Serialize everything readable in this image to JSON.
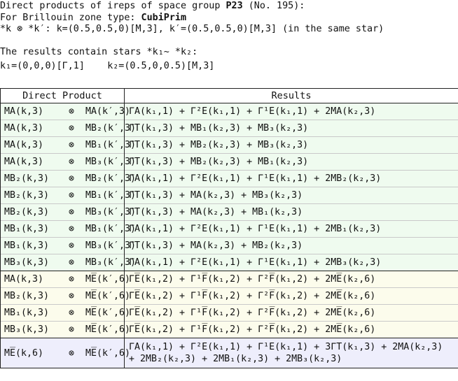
{
  "header": {
    "line1_prefix": "Direct products of ireps of space group ",
    "group_symbol": "P23",
    "group_number": "(No. 195):",
    "line2_prefix": "For Brillouin zone type: ",
    "zone_type": "CubiPrim",
    "line3": "*k ⊗ *k′:  k=(0.5,0.5,0)[M,3],  k′=(0.5,0.5,0)[M,3] (in the same star)",
    "line4": "The results contain stars *k₁~ *k₂:",
    "k1": "k₁=(0,0,0)[Γ,1]",
    "k2": "k₂=(0.5,0,0.5)[M,3]"
  },
  "table": {
    "col_direct_product": "Direct Product",
    "col_results": "Results"
  },
  "colors": {
    "group_green": "#effbef",
    "group_yellow": "#fcfcec",
    "group_blue": "#eeeefc",
    "gray_text": "#8a8a8a"
  },
  "rows": [
    {
      "left": "MA(k,3)",
      "right": "MA(k′,3)",
      "result": "ΓA(k₁,1) + Γ²E(k₁,1) + Γ¹E(k₁,1) + 2MA(k₂,3)",
      "group": "green"
    },
    {
      "left": "MA(k,3)",
      "right": "MB₂(k′,3)",
      "result": "ΓT(k₁,3) + MB₁(k₂,3) + MB₃(k₂,3)",
      "group": "green"
    },
    {
      "left": "MA(k,3)",
      "right": "MB₁(k′,3)",
      "result": "ΓT(k₁,3) + MB₂(k₂,3) + MB₃(k₂,3)",
      "group": "green"
    },
    {
      "left": "MA(k,3)",
      "right": "MB₃(k′,3)",
      "result": "ΓT(k₁,3) + MB₂(k₂,3) + MB₁(k₂,3)",
      "group": "green"
    },
    {
      "left": "MB₂(k,3)",
      "right": "MB₂(k′,3)",
      "result": "ΓA(k₁,1) + Γ²E(k₁,1) + Γ¹E(k₁,1) + 2MB₂(k₂,3)",
      "group": "green"
    },
    {
      "left": "MB₂(k,3)",
      "right": "MB₁(k′,3)",
      "result": "ΓT(k₁,3) + MA(k₂,3) + MB₃(k₂,3)",
      "group": "green"
    },
    {
      "left": "MB₂(k,3)",
      "right": "MB₃(k′,3)",
      "result": "ΓT(k₁,3) + MA(k₂,3) + MB₁(k₂,3)",
      "group": "green"
    },
    {
      "left": "MB₁(k,3)",
      "right": "MB₁(k′,3)",
      "result": "ΓA(k₁,1) + Γ²E(k₁,1) + Γ¹E(k₁,1) + 2MB₁(k₂,3)",
      "group": "green"
    },
    {
      "left": "MB₁(k,3)",
      "right": "MB₃(k′,3)",
      "result": "ΓT(k₁,3) + MA(k₂,3) + MB₂(k₂,3)",
      "group": "green"
    },
    {
      "left": "MB₃(k,3)",
      "right": "MB₃(k′,3)",
      "result": "ΓA(k₁,1) + Γ²E(k₁,1) + Γ¹E(k₁,1) + 2MB₃(k₂,3)",
      "group": "green"
    },
    {
      "left": "MA(k,3)",
      "right": "ME̅(k′,6)",
      "result": "ΓE̅(k₁,2) + Γ¹F̅(k₁,2) + Γ²F̅(k₁,2) + 2ME̅(k₂,6)",
      "group": "yellow"
    },
    {
      "left": "MB₂(k,3)",
      "right": "ME̅(k′,6)",
      "result": "ΓE̅(k₁,2) + Γ¹F̅(k₁,2) + Γ²F̅(k₁,2) + 2ME̅(k₂,6)",
      "group": "yellow"
    },
    {
      "left": "MB₁(k,3)",
      "right": "ME̅(k′,6)",
      "result": "ΓE̅(k₁,2) + Γ¹F̅(k₁,2) + Γ²F̅(k₁,2) + 2ME̅(k₂,6)",
      "group": "yellow"
    },
    {
      "left": "MB₃(k,3)",
      "right": "ME̅(k′,6)",
      "result": "ΓE̅(k₁,2) + Γ¹F̅(k₁,2) + Γ²F̅(k₁,2) + 2ME̅(k₂,6)",
      "group": "yellow"
    },
    {
      "left": "ME̅(k,6)",
      "right": "ME̅(k′,6)",
      "result": "ΓA(k₁,1) + Γ²E(k₁,1) + Γ¹E(k₁,1) + 3ΓT(k₁,3) + 2MA(k₂,3) + 2MB₂(k₂,3) + 2MB₁(k₂,3) + 2MB₃(k₂,3)",
      "group": "blue"
    }
  ]
}
